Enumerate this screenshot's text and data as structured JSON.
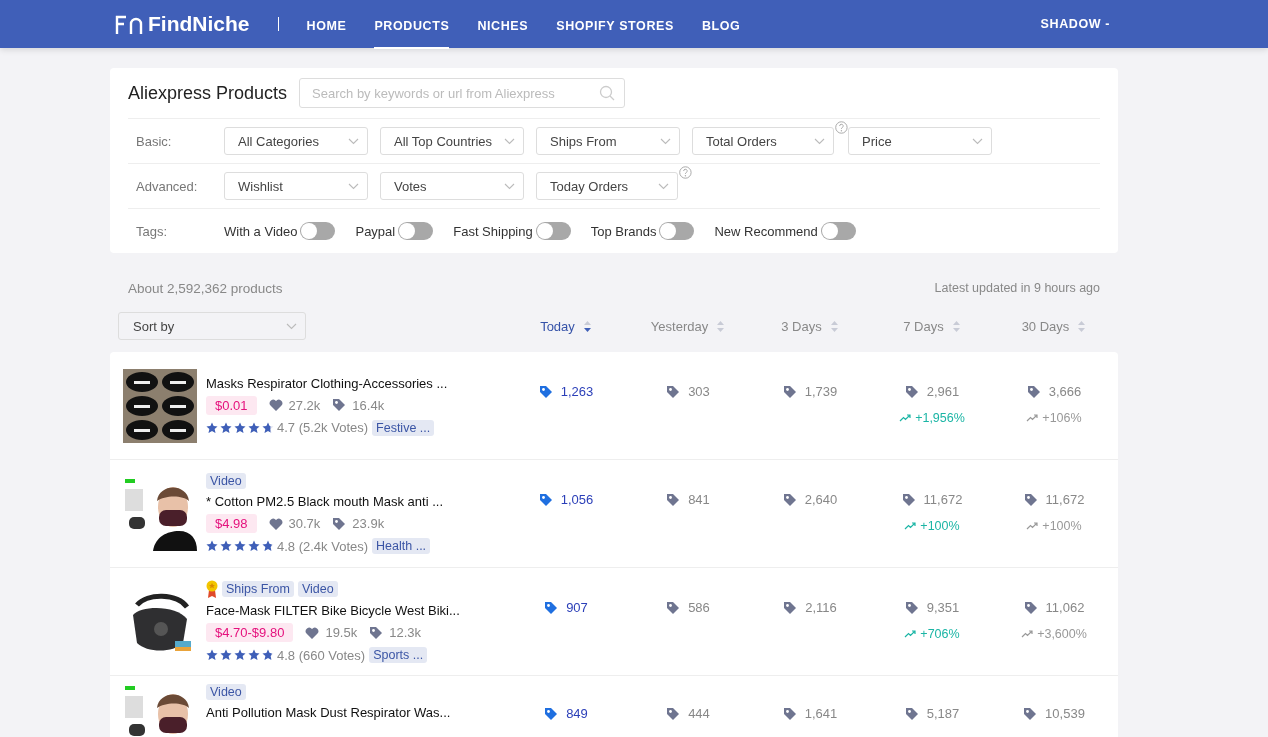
{
  "navbar": {
    "logo": "FindNiche",
    "items": [
      {
        "label": "HOME",
        "selected": false
      },
      {
        "label": "PRODUCTS",
        "selected": true
      },
      {
        "label": "NICHES",
        "selected": false
      },
      {
        "label": "SHOPIFY STORES",
        "selected": false
      },
      {
        "label": "BLOG",
        "selected": false
      }
    ],
    "user": "SHADOW -"
  },
  "filters": {
    "title": "Aliexpress Products",
    "search": {
      "placeholder": "Search by keywords or url from Aliexpress"
    },
    "rows": [
      {
        "label": "Basic:",
        "dropdowns": [
          {
            "label": "All Categories",
            "help": false
          },
          {
            "label": "All Top Countries",
            "help": false
          },
          {
            "label": "Ships From",
            "help": false
          },
          {
            "label": "Total Orders",
            "help": true
          },
          {
            "label": "Price",
            "help": false
          }
        ]
      },
      {
        "label": "Advanced:",
        "dropdowns": [
          {
            "label": "Wishlist",
            "help": false
          },
          {
            "label": "Votes",
            "help": false
          },
          {
            "label": "Today Orders",
            "help": true
          }
        ]
      }
    ],
    "tags_label": "Tags:",
    "tags": [
      {
        "label": "With a Video",
        "on": false
      },
      {
        "label": "Paypal",
        "on": false
      },
      {
        "label": "Fast Shipping",
        "on": false
      },
      {
        "label": "Top Brands",
        "on": false
      },
      {
        "label": "New Recommend",
        "on": false
      }
    ]
  },
  "summary": {
    "count": "About 2,592,362 products",
    "updated": "Latest updated in 9 hours ago"
  },
  "sort": {
    "placeholder": "Sort by",
    "columns": [
      {
        "label": "Today",
        "selected": true
      },
      {
        "label": "Yesterday",
        "selected": false
      },
      {
        "label": "3 Days",
        "selected": false
      },
      {
        "label": "7 Days",
        "selected": false
      },
      {
        "label": "30 Days",
        "selected": false
      }
    ]
  },
  "products": [
    {
      "medal": false,
      "title": "Masks Respirator Clothing-Accessories ...",
      "price": "$0.01",
      "wishlist": "27.2k",
      "orders": "16.4k",
      "stars": 4.7,
      "rating": "4.7 (5.2k Votes)",
      "category": "Festive ...",
      "stats": [
        {
          "value": "1,263"
        },
        {
          "value": "303"
        },
        {
          "value": "1,739"
        },
        {
          "value": "2,961",
          "trend": {
            "text": "+1,956%",
            "highlighted": true
          }
        },
        {
          "value": "3,666",
          "trend": {
            "text": "+106%",
            "highlighted": false
          }
        }
      ]
    },
    {
      "medal": false,
      "badges": [
        "Video"
      ],
      "title": "* Cotton PM2.5 Black mouth Mask anti ...",
      "price": "$4.98",
      "wishlist": "30.7k",
      "orders": "23.9k",
      "stars": 4.8,
      "rating": "4.8 (2.4k Votes)",
      "category": "Health ...",
      "stats": [
        {
          "value": "1,056"
        },
        {
          "value": "841"
        },
        {
          "value": "2,640"
        },
        {
          "value": "11,672",
          "trend": {
            "text": "+100%",
            "highlighted": true
          }
        },
        {
          "value": "11,672",
          "trend": {
            "text": "+100%",
            "highlighted": false
          }
        }
      ]
    },
    {
      "medal": true,
      "badges": [
        "Ships From",
        "Video"
      ],
      "title": "Face-Mask FILTER Bike Bicycle West Biki...",
      "price": "$4.70-$9.80",
      "wishlist": "19.5k",
      "orders": "12.3k",
      "stars": 4.8,
      "rating": "4.8 (660 Votes)",
      "category": "Sports ...",
      "stats": [
        {
          "value": "907"
        },
        {
          "value": "586"
        },
        {
          "value": "2,116"
        },
        {
          "value": "9,351",
          "trend": {
            "text": "+706%",
            "highlighted": true
          }
        },
        {
          "value": "11,062",
          "trend": {
            "text": "+3,600%",
            "highlighted": false
          }
        }
      ]
    },
    {
      "medal": false,
      "badges": [
        "Video"
      ],
      "title": "Anti Pollution Mask Dust Respirator Was...",
      "stats": [
        {
          "value": "849"
        },
        {
          "value": "444"
        },
        {
          "value": "1,641"
        },
        {
          "value": "5,187"
        },
        {
          "value": "10,539"
        }
      ]
    }
  ]
}
